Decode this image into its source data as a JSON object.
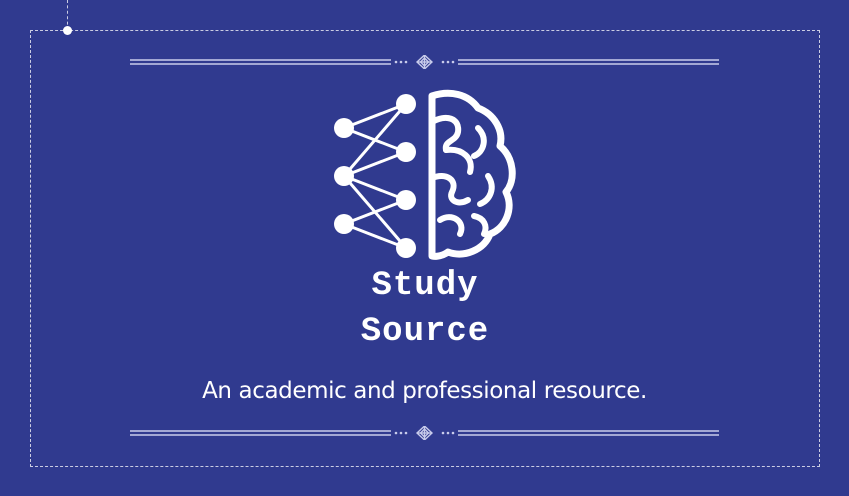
{
  "colors": {
    "background": "#303A8F",
    "foreground": "#FFFFFF",
    "divider": "#C9CCEB"
  },
  "logo": {
    "icon": "brain-network-icon",
    "title_line_1": "Study",
    "title_line_2": "Source",
    "tagline": "An academic and professional resource."
  },
  "ornaments": {
    "top_divider_icon": "diamond-ornament-icon",
    "bottom_divider_icon": "diamond-ornament-icon"
  }
}
